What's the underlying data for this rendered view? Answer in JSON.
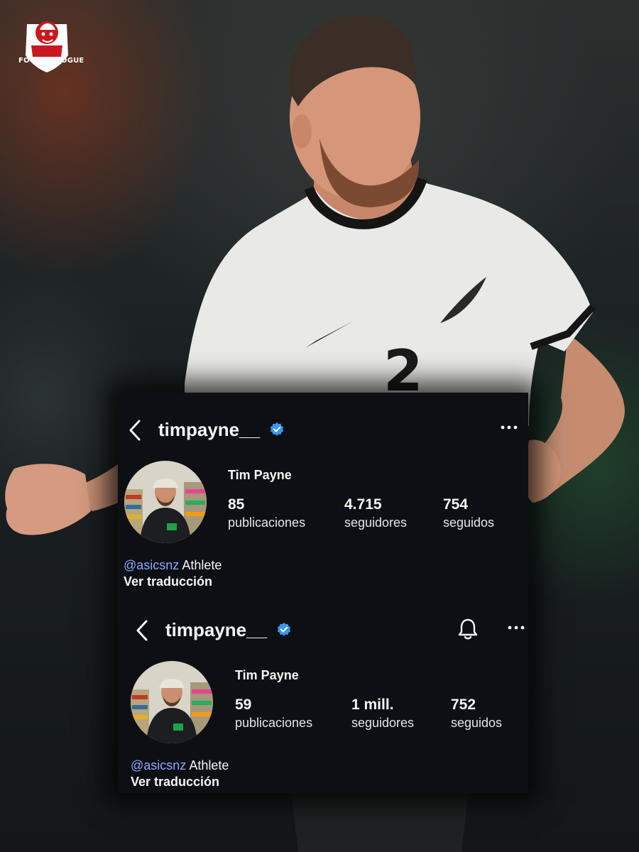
{
  "logo": {
    "brand": "FOOTBALLOGUE"
  },
  "colors": {
    "panel_bg": "#0d0f14",
    "text": "#f5f5f5",
    "verified_blue": "#3897f0",
    "mention_blue": "#8ea6ff"
  },
  "profiles": [
    {
      "username": "timpayne__",
      "verified": true,
      "icons": [
        "chevron-left-icon",
        "verified-badge-icon",
        "more-options-icon"
      ],
      "full_name": "Tim Payne",
      "stats": [
        {
          "value": "85",
          "label": "publicaciones"
        },
        {
          "value": "4.715",
          "label": "seguidores"
        },
        {
          "value": "754",
          "label": "seguidos"
        }
      ],
      "bio_mention": "@asicsnz",
      "bio_text": "Athlete",
      "translate_label": "Ver traducción"
    },
    {
      "username": "timpayne__",
      "verified": true,
      "icons": [
        "chevron-left-icon",
        "verified-badge-icon",
        "bell-icon",
        "more-options-icon"
      ],
      "full_name": "Tim Payne",
      "stats": [
        {
          "value": "59",
          "label": "publicaciones"
        },
        {
          "value": "1 mill.",
          "label": "seguidores"
        },
        {
          "value": "752",
          "label": "seguidos"
        }
      ],
      "bio_mention": "@asicsnz",
      "bio_text": "Athlete",
      "translate_label": "Ver traducción"
    }
  ]
}
